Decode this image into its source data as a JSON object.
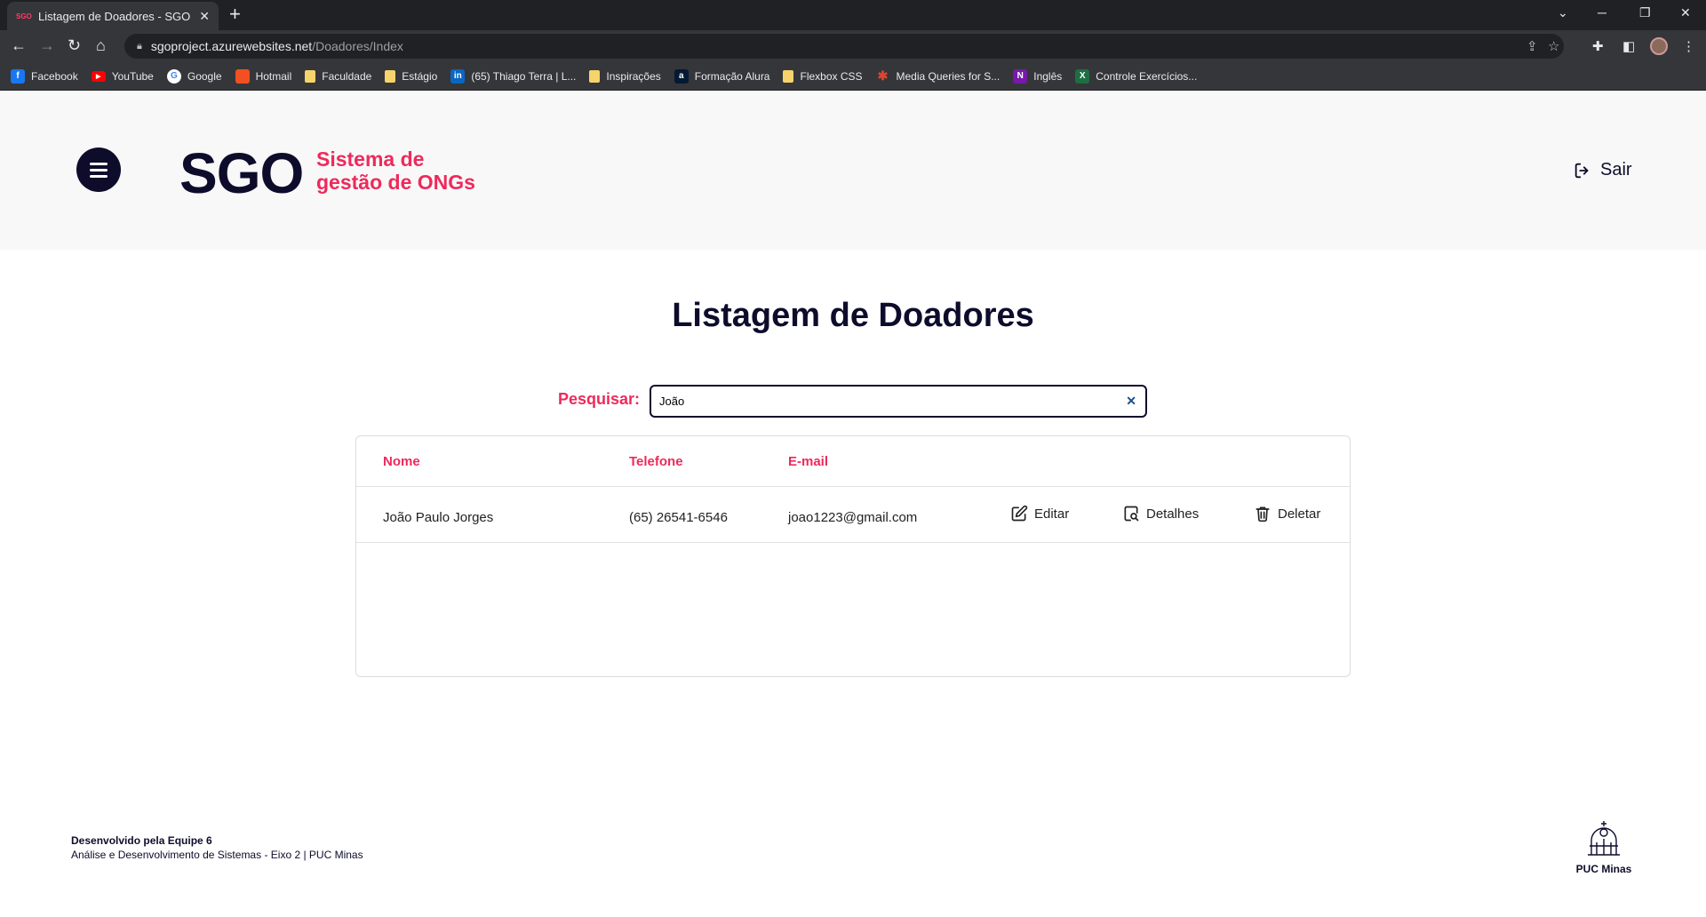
{
  "browser": {
    "tab_favicon": "SGO",
    "tab_title": "Listagem de Doadores - SGO",
    "url_host": "sgoproject.azurewebsites.net",
    "url_path": "/Doadores/Index",
    "bookmarks": [
      {
        "label": "Facebook",
        "icon": "facebook-icon",
        "color": "#1877f2",
        "glyph": "f"
      },
      {
        "label": "YouTube",
        "icon": "youtube-icon",
        "color": "#ff0000",
        "glyph": "▶"
      },
      {
        "label": "Google",
        "icon": "google-icon",
        "color": "#ffffff",
        "glyph": "G"
      },
      {
        "label": "Hotmail",
        "icon": "microsoft-icon",
        "color": "#f25022",
        "glyph": ""
      },
      {
        "label": "Faculdade",
        "icon": "folder-icon",
        "color": "#f6d36b",
        "glyph": ""
      },
      {
        "label": "Estágio",
        "icon": "folder-icon",
        "color": "#f6d36b",
        "glyph": ""
      },
      {
        "label": "(65) Thiago Terra | L...",
        "icon": "linkedin-icon",
        "color": "#0a66c2",
        "glyph": "in"
      },
      {
        "label": "Inspirações",
        "icon": "folder-icon",
        "color": "#f6d36b",
        "glyph": ""
      },
      {
        "label": "Formação Alura",
        "icon": "alura-icon",
        "color": "#051933",
        "glyph": "a"
      },
      {
        "label": "Flexbox CSS",
        "icon": "folder-icon",
        "color": "#f6d36b",
        "glyph": ""
      },
      {
        "label": "Media Queries for S...",
        "icon": "asterisk-icon",
        "color": "#e0442a",
        "glyph": "✱"
      },
      {
        "label": "Inglês",
        "icon": "onenote-icon",
        "color": "#7719aa",
        "glyph": "N"
      },
      {
        "label": "Controle Exercícios...",
        "icon": "excel-icon",
        "color": "#1d6f42",
        "glyph": "X"
      }
    ]
  },
  "header": {
    "logo_mark": "SGO",
    "logo_line1": "Sistema de",
    "logo_line2": "gestão de ONGs",
    "logout_label": "Sair"
  },
  "main": {
    "title": "Listagem de Doadores",
    "search_label": "Pesquisar:",
    "search_value": "João",
    "columns": [
      "Nome",
      "Telefone",
      "E-mail"
    ],
    "rows": [
      {
        "nome": "João Paulo Jorges",
        "telefone": "(65) 26541-6546",
        "email": "joao1223@gmail.com",
        "edit_label": "Editar",
        "details_label": "Detalhes",
        "delete_label": "Deletar"
      }
    ]
  },
  "footer": {
    "line1": "Desenvolvido pela Equipe 6",
    "line2": "Análise e Desenvolvimento de Sistemas - Eixo 2 | PUC Minas",
    "logo_name": "PUC Minas"
  },
  "colors": {
    "accent": "#ee2a5b",
    "dark": "#0d0c2b",
    "header_bg": "#f8f8f8"
  }
}
